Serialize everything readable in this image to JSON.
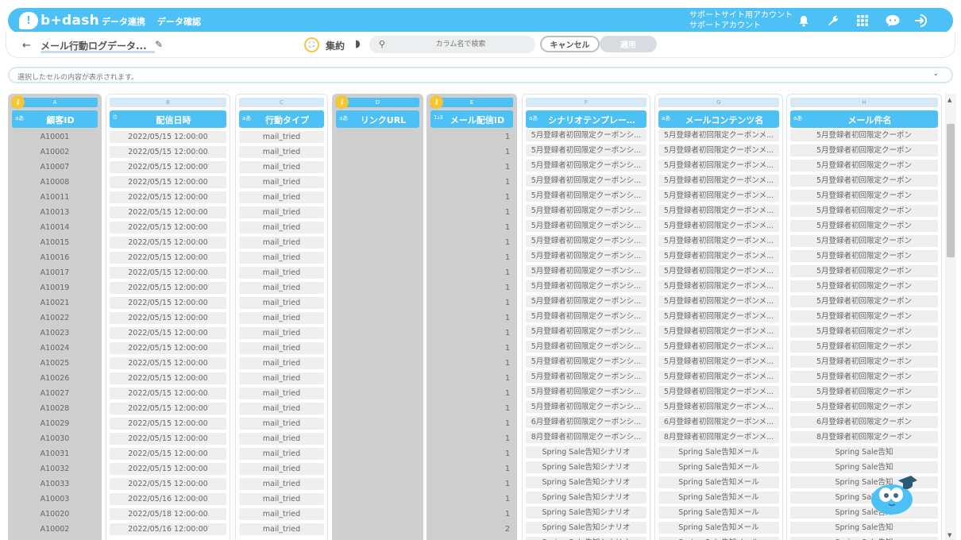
{
  "header": {
    "logo_text": "b+dash",
    "nav": [
      "データ連携",
      "データ確認"
    ],
    "account_line1": "サポートサイト用アカウント",
    "account_line2": "サポートアカウント",
    "icons": [
      "bell-icon",
      "wrench-icon",
      "apps-grid-icon",
      "chat-icon",
      "logout-icon"
    ]
  },
  "toolbar": {
    "back": "←",
    "title": "メール行動ログデータ...",
    "summary_label": "集約",
    "search_placeholder": "カラム名で検索",
    "cancel_label": "キャンセル",
    "apply_label": "適用"
  },
  "cellbar": {
    "placeholder": "選択したセルの内容が表示されます。"
  },
  "columns": [
    {
      "letter": "A",
      "name": "顧客ID",
      "type_icon": "aあ",
      "key": true,
      "cells": [
        "A10001",
        "A10002",
        "A10007",
        "A10008",
        "A10011",
        "A10013",
        "A10014",
        "A10015",
        "A10016",
        "A10017",
        "A10019",
        "A10021",
        "A10022",
        "A10023",
        "A10024",
        "A10025",
        "A10026",
        "A10027",
        "A10028",
        "A10029",
        "A10030",
        "A10031",
        "A10032",
        "A10033",
        "A10003",
        "A10020",
        "A10002"
      ]
    },
    {
      "letter": "B",
      "name": "配信日時",
      "type_icon": "⏱",
      "key": false,
      "cells": [
        "2022/05/15 12:00:00",
        "2022/05/15 12:00:00",
        "2022/05/15 12:00:00",
        "2022/05/15 12:00:00",
        "2022/05/15 12:00:00",
        "2022/05/15 12:00:00",
        "2022/05/15 12:00:00",
        "2022/05/15 12:00:00",
        "2022/05/15 12:00:00",
        "2022/05/15 12:00:00",
        "2022/05/15 12:00:00",
        "2022/05/15 12:00:00",
        "2022/05/15 12:00:00",
        "2022/05/15 12:00:00",
        "2022/05/15 12:00:00",
        "2022/05/15 12:00:00",
        "2022/05/15 12:00:00",
        "2022/05/15 12:00:00",
        "2022/05/15 12:00:00",
        "2022/05/15 12:00:00",
        "2022/05/15 12:00:00",
        "2022/05/15 12:00:00",
        "2022/05/15 12:00:00",
        "2022/05/15 12:00:00",
        "2022/05/16 12:00:00",
        "2022/05/18 12:00:00",
        "2022/05/16 12:00:00"
      ]
    },
    {
      "letter": "C",
      "name": "行動タイプ",
      "type_icon": "aあ",
      "key": false,
      "cells": [
        "mail_tried",
        "mail_tried",
        "mail_tried",
        "mail_tried",
        "mail_tried",
        "mail_tried",
        "mail_tried",
        "mail_tried",
        "mail_tried",
        "mail_tried",
        "mail_tried",
        "mail_tried",
        "mail_tried",
        "mail_tried",
        "mail_tried",
        "mail_tried",
        "mail_tried",
        "mail_tried",
        "mail_tried",
        "mail_tried",
        "mail_tried",
        "mail_tried",
        "mail_tried",
        "mail_tried",
        "mail_tried",
        "mail_tried",
        "mail_tried"
      ]
    },
    {
      "letter": "D",
      "name": "リンクURL",
      "type_icon": "aあ",
      "key": true,
      "cells": []
    },
    {
      "letter": "E",
      "name": "メール配信ID",
      "type_icon": "1₂3",
      "key": true,
      "numeric": true,
      "cells": [
        "1",
        "1",
        "1",
        "1",
        "1",
        "1",
        "1",
        "1",
        "1",
        "1",
        "1",
        "1",
        "1",
        "1",
        "1",
        "1",
        "1",
        "1",
        "1",
        "1",
        "1",
        "1",
        "1",
        "1",
        "1",
        "1",
        "2"
      ]
    },
    {
      "letter": "F",
      "name": "シナリオテンプレー…",
      "type_icon": "aあ",
      "key": false,
      "text_cells": true,
      "cells": [
        "5月登録者初回限定クーポンシ...",
        "5月登録者初回限定クーポンシ...",
        "5月登録者初回限定クーポンシ...",
        "5月登録者初回限定クーポンシ...",
        "5月登録者初回限定クーポンシ...",
        "5月登録者初回限定クーポンシ...",
        "5月登録者初回限定クーポンシ...",
        "5月登録者初回限定クーポンシ...",
        "5月登録者初回限定クーポンシ...",
        "5月登録者初回限定クーポンシ...",
        "5月登録者初回限定クーポンシ...",
        "5月登録者初回限定クーポンシ...",
        "5月登録者初回限定クーポンシ...",
        "5月登録者初回限定クーポンシ...",
        "5月登録者初回限定クーポンシ...",
        "5月登録者初回限定クーポンシ...",
        "5月登録者初回限定クーポンシ...",
        "5月登録者初回限定クーポンシ...",
        "5月登録者初回限定クーポンシ...",
        "6月登録者初回限定クーポンシ...",
        "8月登録者初回限定クーポンシ...",
        "Spring Sale告知シナリオ",
        "Spring Sale告知シナリオ",
        "Spring Sale告知シナリオ",
        "Spring Sale告知シナリオ",
        "Spring Sale告知シナリオ",
        "Spring Sale告知シナリオ",
        "Spring Sale告知シナリオ"
      ]
    },
    {
      "letter": "G",
      "name": "メールコンテンツ名",
      "type_icon": "aあ",
      "key": false,
      "text_cells": true,
      "cells": [
        "5月登録者初回限定クーポンメ...",
        "5月登録者初回限定クーポンメ...",
        "5月登録者初回限定クーポンメ...",
        "5月登録者初回限定クーポンメ...",
        "5月登録者初回限定クーポンメ...",
        "5月登録者初回限定クーポンメ...",
        "5月登録者初回限定クーポンメ...",
        "5月登録者初回限定クーポンメ...",
        "5月登録者初回限定クーポンメ...",
        "5月登録者初回限定クーポンメ...",
        "5月登録者初回限定クーポンメ...",
        "5月登録者初回限定クーポンメ...",
        "5月登録者初回限定クーポンメ...",
        "5月登録者初回限定クーポンメ...",
        "5月登録者初回限定クーポンメ...",
        "5月登録者初回限定クーポンメ...",
        "5月登録者初回限定クーポンメ...",
        "5月登録者初回限定クーポンメ...",
        "5月登録者初回限定クーポンメ...",
        "6月登録者初回限定クーポンメ...",
        "8月登録者初回限定クーポンメ...",
        "Spring Sale告知メール",
        "Spring Sale告知メール",
        "Spring Sale告知メール",
        "Spring Sale告知メール",
        "Spring Sale告知メール",
        "Spring Sale告知メール",
        "Spring Sale告知メール"
      ]
    },
    {
      "letter": "H",
      "name": "メール件名",
      "type_icon": "aあ",
      "key": false,
      "text_cells": true,
      "cells": [
        "5月登録者初回限定クーポン",
        "5月登録者初回限定クーポン",
        "5月登録者初回限定クーポン",
        "5月登録者初回限定クーポン",
        "5月登録者初回限定クーポン",
        "5月登録者初回限定クーポン",
        "5月登録者初回限定クーポン",
        "5月登録者初回限定クーポン",
        "5月登録者初回限定クーポン",
        "5月登録者初回限定クーポン",
        "5月登録者初回限定クーポン",
        "5月登録者初回限定クーポン",
        "5月登録者初回限定クーポン",
        "5月登録者初回限定クーポン",
        "5月登録者初回限定クーポン",
        "5月登録者初回限定クーポン",
        "5月登録者初回限定クーポン",
        "5月登録者初回限定クーポン",
        "5月登録者初回限定クーポン",
        "6月登録者初回限定クーポン",
        "8月登録者初回限定クーポン",
        "Spring Sale告知",
        "Spring Sale告知",
        "Spring Sale告知",
        "Spring Sale告知",
        "Spring Sale告知",
        "Spring Sale告知",
        "Spring Sale告知"
      ]
    }
  ],
  "colors": {
    "accent": "#4dc1f5",
    "key_badge": "#f7c531",
    "key_column_bg": "#cfcfcf"
  }
}
